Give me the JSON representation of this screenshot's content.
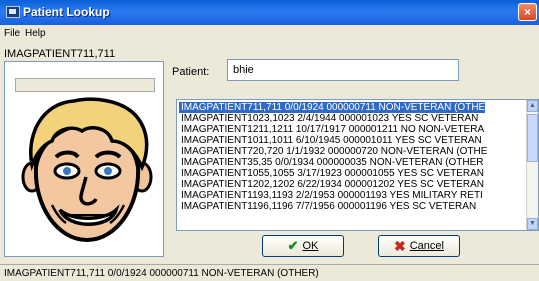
{
  "window": {
    "title": "Patient Lookup",
    "close_glyph": "×"
  },
  "menu": {
    "items": [
      {
        "label": "File"
      },
      {
        "label": "Help"
      }
    ]
  },
  "left_panel": {
    "patient_name": "IMAGPATIENT711,711"
  },
  "search": {
    "label": "Patient:",
    "value": "bhie"
  },
  "results": {
    "selected_index": 0,
    "rows": [
      "IMAGPATIENT711,711  0/0/1924  000000711      NON-VETERAN (OTHE",
      "IMAGPATIENT1023,1023  2/4/1944  000001023  YES  SC VETERAN",
      "IMAGPATIENT1211,1211  10/17/1917  000001211  NO  NON-VETERA",
      "IMAGPATIENT1011,1011  6/10/1945  000001011  YES  SC VETERAN",
      "IMAGPATIENT720,720  1/1/1932  000000720      NON-VETERAN (OTHE",
      "IMAGPATIENT35,35  0/0/1934  000000035      NON-VETERAN (OTHER",
      "IMAGPATIENT1055,1055  3/17/1923  000001055  YES  SC VETERAN",
      "IMAGPATIENT1202,1202  6/22/1934  000001202  YES  SC VETERAN",
      "IMAGPATIENT1193,1193  2/2/1953  000001193  YES  MILITARY RETI",
      "IMAGPATIENT1196,1196  7/7/1956  000001196  YES  SC VETERAN"
    ]
  },
  "buttons": {
    "ok": {
      "label": "OK",
      "icon": "check-icon"
    },
    "cancel": {
      "label": "Cancel",
      "icon": "x-icon"
    }
  },
  "status": {
    "text": "IMAGPATIENT711,711  0/0/1924  000000711      NON-VETERAN (OTHER)"
  },
  "colors": {
    "title_bar": "#1960dd",
    "selection": "#316ac5",
    "background": "#ece9d8"
  }
}
